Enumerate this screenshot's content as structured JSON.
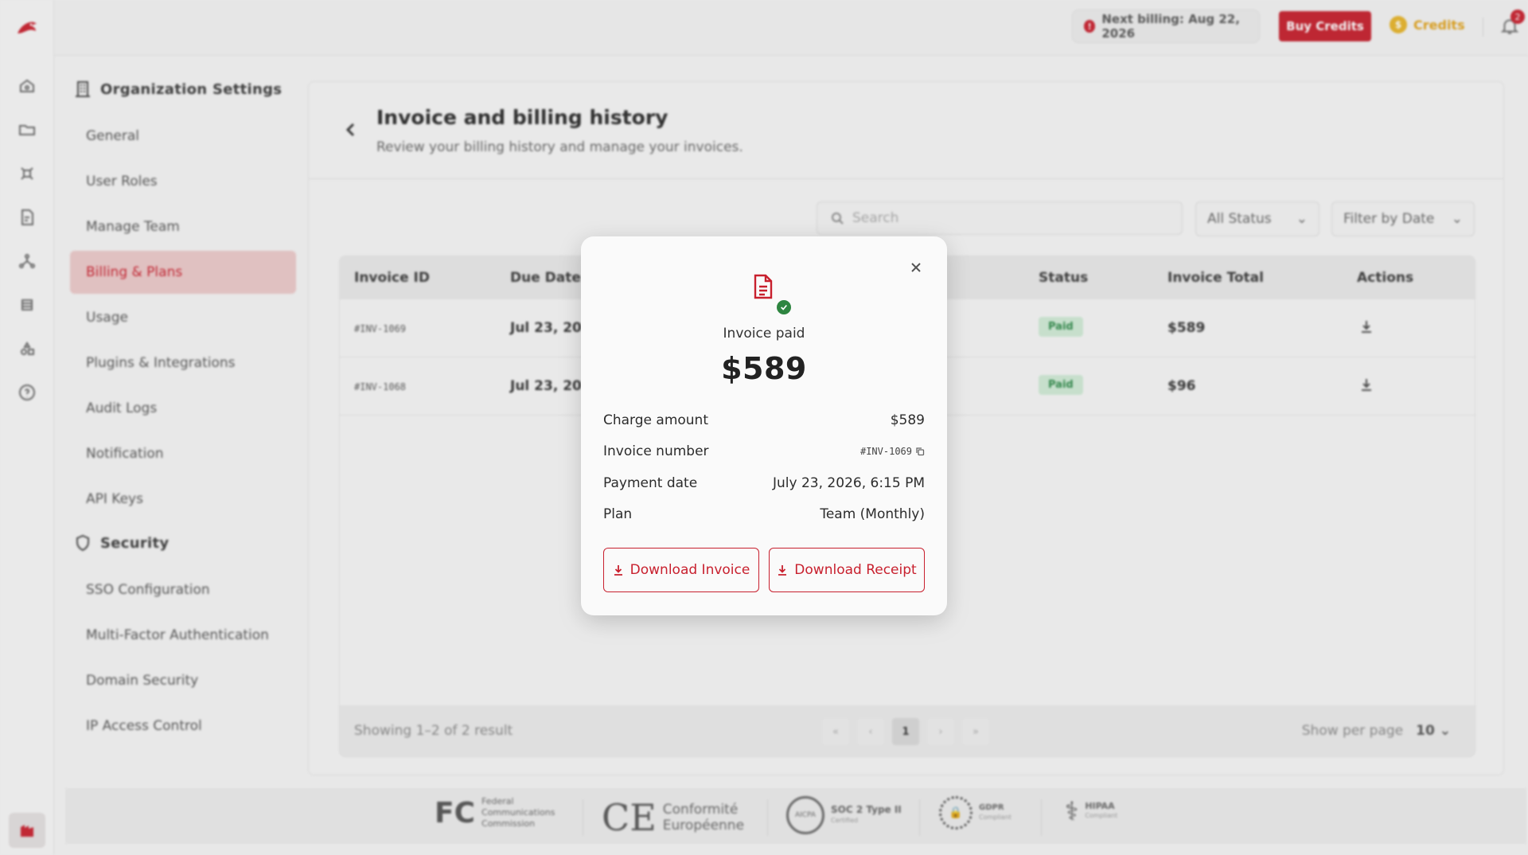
{
  "topbar": {
    "next_billing": "Next billing: Aug 22, 2026",
    "buy_credits": "Buy Credits",
    "credits": "Credits",
    "notification_count": "2"
  },
  "settings_nav": {
    "org_header": "Organization Settings",
    "items": [
      "General",
      "User Roles",
      "Manage Team",
      "Billing & Plans",
      "Usage",
      "Plugins & Integrations",
      "Audit Logs",
      "Notification",
      "API Keys"
    ],
    "security_header": "Security",
    "security_items": [
      "SSO Configuration",
      "Multi-Factor Authentication",
      "Domain Security",
      "IP Access Control"
    ],
    "active": "Billing & Plans"
  },
  "page": {
    "title": "Invoice and billing history",
    "subtitle": "Review your billing history and manage your invoices."
  },
  "filters": {
    "search_placeholder": "Search",
    "status": "All Status",
    "date": "Filter by Date"
  },
  "table": {
    "headers": {
      "invoice_id": "Invoice ID",
      "due_date": "Due Date",
      "status": "Status",
      "invoice_total": "Invoice Total",
      "actions": "Actions"
    },
    "rows": [
      {
        "invoice_id": "#INV-1069",
        "due_date": "Jul 23, 2026",
        "status": "Paid",
        "total": "$589"
      },
      {
        "invoice_id": "#INV-1068",
        "due_date": "Jul 23, 2026",
        "status": "Paid",
        "total": "$96"
      }
    ],
    "showing": "Showing 1–2 of 2 result",
    "pager": {
      "first": "«",
      "prev": "‹",
      "current": "1",
      "next": "›",
      "last": "»"
    },
    "per_page_label": "Show per page",
    "per_page": "10"
  },
  "certifications": [
    {
      "mark": "FC",
      "text": "Federal Communications Commission"
    },
    {
      "mark": "CE",
      "text": "Conformité Européenne"
    },
    {
      "mark": "AICPA",
      "text": "SOC 2 Type II",
      "sub": "Certified"
    },
    {
      "mark": "GDPR",
      "text": "GDPR",
      "sub": "Compliant"
    },
    {
      "mark": "HIPAA",
      "text": "HIPAA",
      "sub": "Compliant"
    }
  ],
  "modal": {
    "status": "Invoice paid",
    "amount": "$589",
    "details": {
      "charge_label": "Charge amount",
      "charge_value": "$589",
      "invoice_label": "Invoice number",
      "invoice_value": "#INV-1069",
      "date_label": "Payment date",
      "date_value": "July 23, 2026, 6:15 PM",
      "plan_label": "Plan",
      "plan_value": "Team (Monthly)"
    },
    "download_invoice": "Download Invoice",
    "download_receipt": "Download Receipt"
  },
  "colors": {
    "brand": "#c8202e",
    "paid_bg": "#cfead5",
    "paid_text": "#2f8a4a",
    "coin": "#e6b42a",
    "success": "#2e8540"
  }
}
